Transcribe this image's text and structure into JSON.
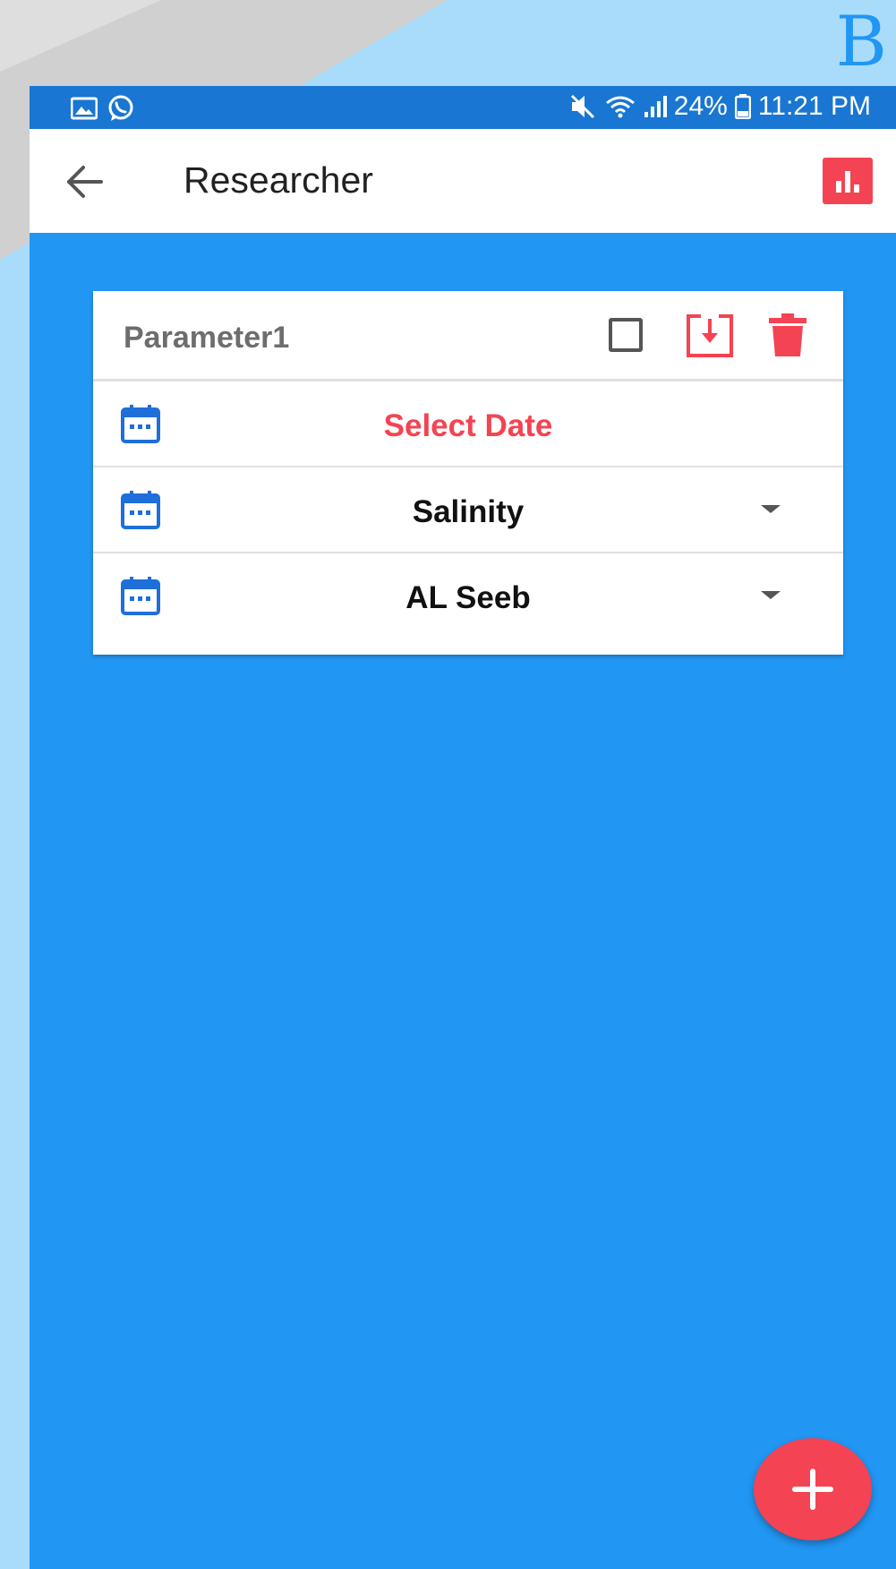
{
  "figure_label": "B",
  "status_bar": {
    "battery": "24%",
    "time": "11:21 PM"
  },
  "appbar": {
    "title": "Researcher"
  },
  "card": {
    "title": "Parameter1",
    "rows": [
      {
        "label": "Select Date",
        "color": "#f44352"
      },
      {
        "label": "Salinity",
        "color": "#111111"
      },
      {
        "label": "AL Seeb",
        "color": "#111111"
      }
    ]
  },
  "colors": {
    "accent_red": "#f44352",
    "background_blue": "#2196f3",
    "status_bar_blue": "#1976d2"
  }
}
